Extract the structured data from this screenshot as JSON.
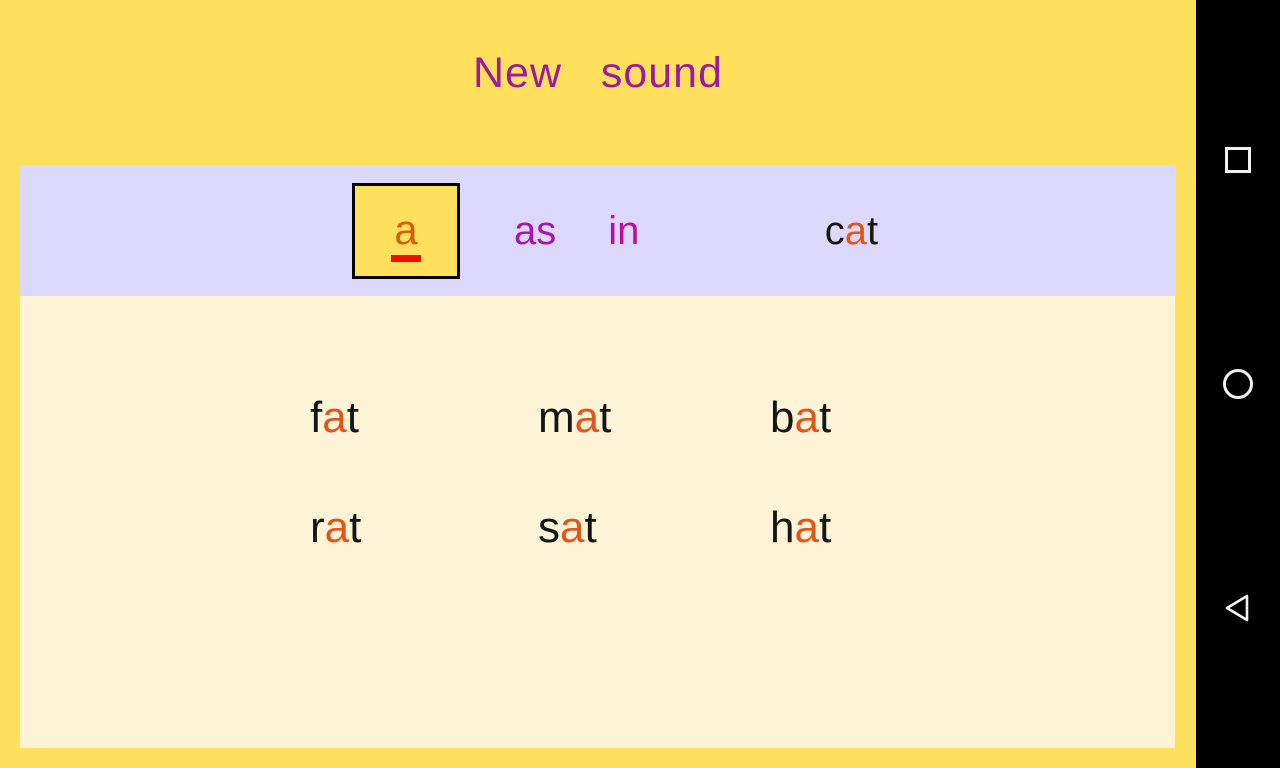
{
  "app": {
    "title": "New   sound",
    "title_color": "#9c1ba3",
    "background_color": "#ffe05c"
  },
  "sound_strip": {
    "background_color": "#dcd8fb",
    "letter_tile": {
      "letter": "a",
      "letter_color": "#d2600f",
      "underline_color": "#ee1100",
      "tile_background": "#ffe05c",
      "tile_border_color": "#000000"
    },
    "phrase": [
      {
        "text": "as",
        "color": "#a913b4"
      },
      {
        "text": "in",
        "color": "#c20d9c"
      }
    ],
    "example_word": {
      "text": "cat",
      "parts": [
        {
          "text": "c",
          "color": "#141414",
          "role": "consonant"
        },
        {
          "text": "a",
          "color": "#e0551a",
          "role": "vowel"
        },
        {
          "text": "t",
          "color": "#141414",
          "role": "consonant"
        }
      ]
    }
  },
  "word_area": {
    "background_color": "#fdf3d7",
    "vowel_color": "#e0551a",
    "consonant_color": "#161616",
    "rows": [
      [
        {
          "onset": "f",
          "vowel": "a",
          "coda": "t"
        },
        {
          "onset": "m",
          "vowel": "a",
          "coda": "t"
        },
        {
          "onset": "b",
          "vowel": "a",
          "coda": "t"
        }
      ],
      [
        {
          "onset": "r",
          "vowel": "a",
          "coda": "t"
        },
        {
          "onset": "s",
          "vowel": "a",
          "coda": "t"
        },
        {
          "onset": "h",
          "vowel": "a",
          "coda": "t"
        }
      ]
    ]
  },
  "nav_bar": {
    "background_color": "#000000",
    "icon_color": "#f2f2f2",
    "buttons": [
      {
        "name": "recents",
        "icon": "square-icon"
      },
      {
        "name": "home",
        "icon": "circle-icon"
      },
      {
        "name": "back",
        "icon": "triangle-left-icon"
      }
    ]
  }
}
